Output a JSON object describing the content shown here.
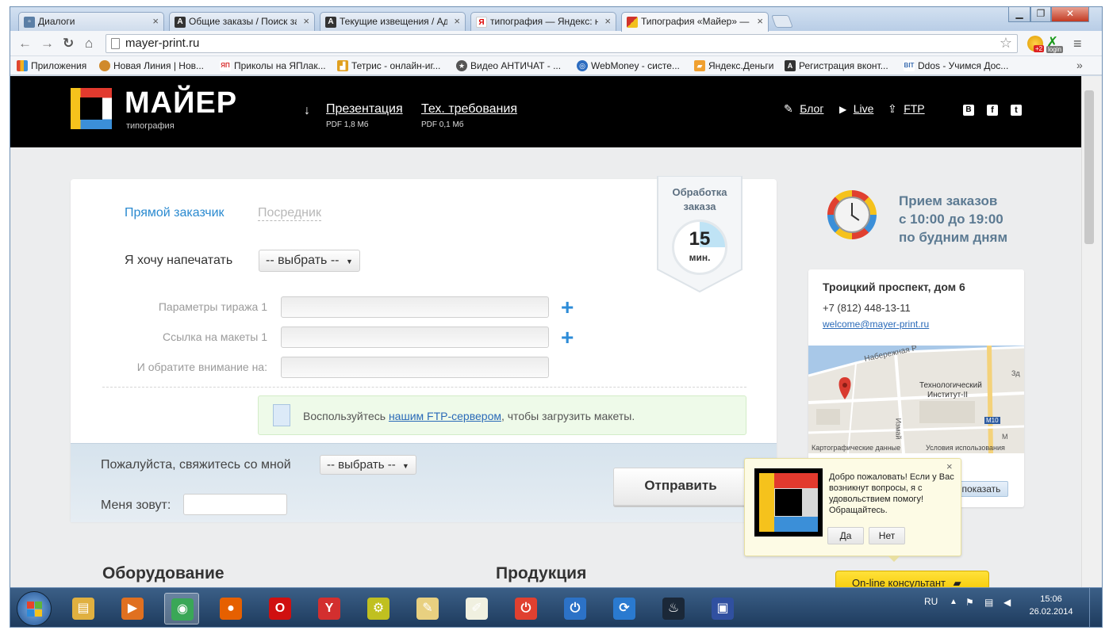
{
  "browser": {
    "tabs": [
      {
        "title": "Диалоги",
        "favicon": "vk-dialog-icon",
        "color": "#5b7fa6",
        "glyph": "▫"
      },
      {
        "title": "Общие заказы / Поиск за",
        "favicon": "a-icon",
        "color": "#333333",
        "glyph": "A"
      },
      {
        "title": "Текущие извещения / Ад",
        "favicon": "a-icon",
        "color": "#333333",
        "glyph": "A"
      },
      {
        "title": "типография — Яндекс: на",
        "favicon": "yandex-icon",
        "color": "#e8e8e8",
        "glyph": "Я"
      },
      {
        "title": "Типография «Майер» —",
        "favicon": "mayer-icon",
        "color": "#d0342c",
        "glyph": "■"
      }
    ],
    "url": "mayer-print.ru",
    "bookmarks": [
      {
        "label": "Приложения",
        "icon": "apps-icon",
        "color": "#e0462f"
      },
      {
        "label": "Новая Линия | Нов...",
        "icon": "newline-icon",
        "color": "#d08a2c"
      },
      {
        "label": "Приколы на ЯПлак...",
        "icon": "yap-icon",
        "color": "#d93030"
      },
      {
        "label": "Тетрис - онлайн-иг...",
        "icon": "tetris-icon",
        "color": "#e0a020"
      },
      {
        "label": "Видео АНТИЧАТ - ...",
        "icon": "antichat-icon",
        "color": "#555555"
      },
      {
        "label": "WebMoney - систе...",
        "icon": "webmoney-icon",
        "color": "#2c6cc0"
      },
      {
        "label": "Яндекс.Деньги",
        "icon": "yandex-money-icon",
        "color": "#f0a030"
      },
      {
        "label": "Регистрация вконт...",
        "icon": "a-icon",
        "color": "#333333"
      },
      {
        "label": "Ddos - Учимся Дос...",
        "icon": "bit-icon",
        "color": "#3b6db0"
      }
    ],
    "overflow_glyph": "»",
    "login_badge": "login",
    "ext_badge": "+2"
  },
  "header": {
    "logo_title": "МАЙЕР",
    "logo_sub": "типография",
    "links": [
      {
        "label": "Презентация",
        "sub": "PDF 1,8 Мб"
      },
      {
        "label": "Тех. требования",
        "sub": "PDF 0,1 Мб"
      }
    ],
    "right_links": [
      {
        "label": "Блог",
        "icon": "pencil-icon"
      },
      {
        "label": "Live",
        "icon": "play-icon"
      },
      {
        "label": "FTP",
        "icon": "upload-icon"
      }
    ],
    "social": [
      "В",
      "f",
      "t"
    ]
  },
  "order": {
    "tab_active": "Прямой заказчик",
    "tab_inactive": "Посредник",
    "print_label": "Я хочу напечатать",
    "print_select": "-- выбрать --",
    "fields": [
      {
        "label": "Параметры тиража 1",
        "has_plus": true
      },
      {
        "label": "Ссылка на макеты 1",
        "has_plus": true
      },
      {
        "label": "И обратите внимание на:",
        "has_plus": false
      }
    ],
    "ftp_pre": "Воспользуйтесь ",
    "ftp_link": "нашим FTP-сервером",
    "ftp_post": ", чтобы загрузить макеты.",
    "contact_label": "Пожалуйста, свяжитесь со мной",
    "contact_select": "-- выбрать --",
    "name_label": "Меня зовут:",
    "submit_label": "Отправить"
  },
  "badge": {
    "line1": "Обработка",
    "line2": "заказа",
    "number": "15",
    "unit": "мин."
  },
  "hours": {
    "line1": "Прием заказов",
    "line2": "с 10:00 до 19:00",
    "line3": "по будним дням"
  },
  "contacts": {
    "address": "Троицкий проспект, дом 6",
    "phone": "+7 (812) 448-13-11",
    "email": "welcome@mayer-print.ru",
    "map_labels": [
      "Набережная Р",
      "Технологический",
      "Институт-II",
      "М10",
      "Измай",
      "Зд",
      "М"
    ],
    "map_footer_left": "Картографические данные",
    "map_footer_right": "Условия использования",
    "show_button": "показать"
  },
  "popup": {
    "text": "Добро пожаловать! Если у Вас возникнут вопросы, я с удовольствием помогу! Обращайтесь.",
    "yes": "Да",
    "no": "Нет",
    "close": "×"
  },
  "consultant": {
    "label": "On-line консультант"
  },
  "sections": {
    "left": "Оборудование",
    "right": "Продукция"
  },
  "taskbar": {
    "lang": "RU",
    "time": "15:06",
    "date": "26.02.2014",
    "apps": [
      {
        "icon": "explorer-icon",
        "color": "#e0b040",
        "glyph": "▤"
      },
      {
        "icon": "media-player-icon",
        "color": "#e07020",
        "glyph": "▶"
      },
      {
        "icon": "chrome-icon",
        "color": "#3aa757",
        "glyph": "◉"
      },
      {
        "icon": "firefox-icon",
        "color": "#e66000",
        "glyph": "●"
      },
      {
        "icon": "opera-icon",
        "color": "#d01010",
        "glyph": "O"
      },
      {
        "icon": "yandex-browser-icon",
        "color": "#d32f2f",
        "glyph": "Y"
      },
      {
        "icon": "network-tool-icon",
        "color": "#c0c020",
        "glyph": "⚙"
      },
      {
        "icon": "paint-icon",
        "color": "#e8d080",
        "glyph": "✎"
      },
      {
        "icon": "notepad-icon",
        "color": "#f0f0e0",
        "glyph": "✐"
      },
      {
        "icon": "power-tool-icon",
        "color": "#e04030",
        "glyph": "⏻"
      },
      {
        "icon": "power-button-icon",
        "color": "#2c72c7",
        "glyph": "⏻"
      },
      {
        "icon": "sync-icon",
        "color": "#2a7ad0",
        "glyph": "⟳"
      },
      {
        "icon": "steam-icon",
        "color": "#1b2838",
        "glyph": "♨"
      },
      {
        "icon": "floppy-icon",
        "color": "#3050a0",
        "glyph": "▣"
      }
    ]
  }
}
